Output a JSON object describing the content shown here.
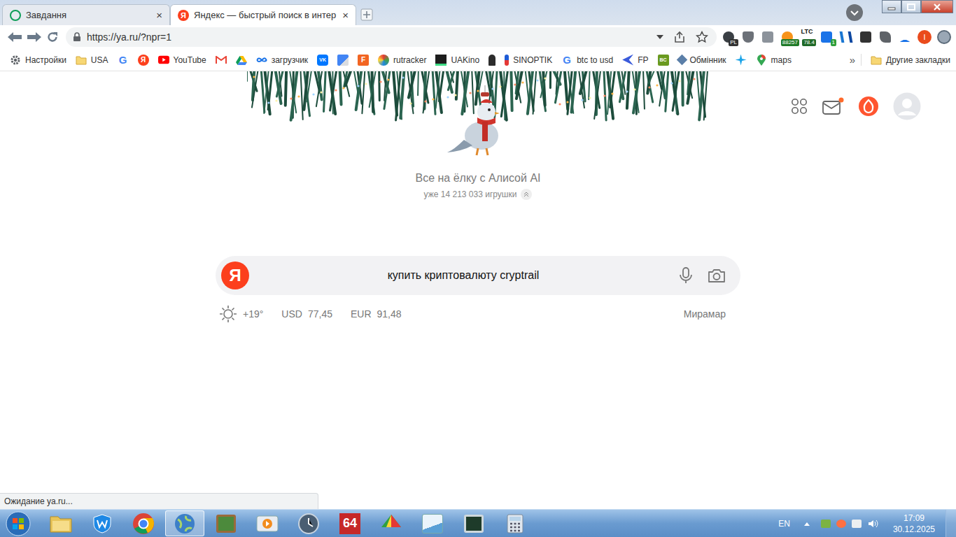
{
  "browser": {
    "tabs": [
      {
        "title": "Завдання",
        "kind": "task",
        "selected": false,
        "close": "×"
      },
      {
        "title": "Яндекс — быстрый поиск в интер",
        "kind": "yandex",
        "logo": "Я",
        "selected": true,
        "close": "×"
      }
    ],
    "address": {
      "url": "https://ya.ru/?npr=1"
    },
    "extensions": [
      {
        "kind": "globe",
        "badge": "PL"
      },
      {
        "kind": "shield"
      },
      {
        "kind": "case"
      },
      {
        "kind": "btc",
        "badge": "88257"
      },
      {
        "kind": "ltc",
        "label": "LTC",
        "badge": "78.4"
      },
      {
        "kind": "dlblue",
        "badge": "1"
      },
      {
        "kind": "ymark"
      },
      {
        "kind": "terminal"
      },
      {
        "kind": "puzzle"
      },
      {
        "kind": "download"
      },
      {
        "kind": "profile",
        "glyph": "I"
      },
      {
        "kind": "blob"
      }
    ],
    "bookmarks": [
      {
        "label": "Настройки",
        "kind": "gear"
      },
      {
        "label": "USA",
        "kind": "folder"
      },
      {
        "kind": "google",
        "glyph": "G"
      },
      {
        "kind": "yandex",
        "glyph": "Я"
      },
      {
        "label": "YouTube",
        "kind": "youtube"
      },
      {
        "kind": "gmail"
      },
      {
        "kind": "drive"
      },
      {
        "label": "загрузчик",
        "kind": "infinity"
      },
      {
        "kind": "vk",
        "glyph": "VK"
      },
      {
        "kind": "translate"
      },
      {
        "kind": "ffav",
        "glyph": "F"
      },
      {
        "label": "rutracker",
        "kind": "spark"
      },
      {
        "label": "UAKino",
        "kind": "dark"
      },
      {
        "kind": "chess"
      },
      {
        "label": "SINOPTIK",
        "kind": "thermo"
      },
      {
        "label": "btc to usd",
        "kind": "google",
        "glyph": "G"
      },
      {
        "label": "FP",
        "kind": "fp"
      },
      {
        "kind": "bc",
        "glyph": "BC"
      },
      {
        "label": "Обмінник",
        "kind": "diamond"
      },
      {
        "kind": "star"
      },
      {
        "label": "maps",
        "kind": "pin"
      }
    ],
    "bookmarks_more": "»",
    "other_bookmarks": "Другие закладки"
  },
  "page": {
    "header_icons": [
      {
        "kind": "grid"
      },
      {
        "kind": "mail",
        "notification": true
      },
      {
        "kind": "alice"
      },
      {
        "kind": "avatar"
      }
    ],
    "promo": {
      "title": "Все на ёлку с Алисой AI",
      "count": "уже 14 213 033 игрушки"
    },
    "search": {
      "logo": "Я",
      "query": "купить криптовалюту cryptrail"
    },
    "info": {
      "weather": "+19°",
      "rates": [
        {
          "code": "USD",
          "value": "77,45"
        },
        {
          "code": "EUR",
          "value": "91,48"
        }
      ],
      "location": "Мирамар"
    }
  },
  "status_bar": {
    "text": "Ожидание ya.ru..."
  },
  "taskbar": {
    "items": [
      {
        "kind": "folder",
        "selected": false
      },
      {
        "kind": "wise",
        "selected": false
      },
      {
        "kind": "chrome",
        "selected": false
      },
      {
        "kind": "globe",
        "selected": true
      },
      {
        "kind": "board",
        "selected": false
      },
      {
        "kind": "player",
        "selected": false
      },
      {
        "kind": "clock",
        "selected": false
      },
      {
        "kind": "aida",
        "label": "64",
        "selected": false
      },
      {
        "kind": "paint",
        "selected": false
      },
      {
        "kind": "notepad",
        "selected": false
      },
      {
        "kind": "monitor",
        "selected": false
      },
      {
        "kind": "calc",
        "selected": false
      }
    ],
    "language": "EN",
    "time": "17:09",
    "date": "30.12.2025"
  }
}
